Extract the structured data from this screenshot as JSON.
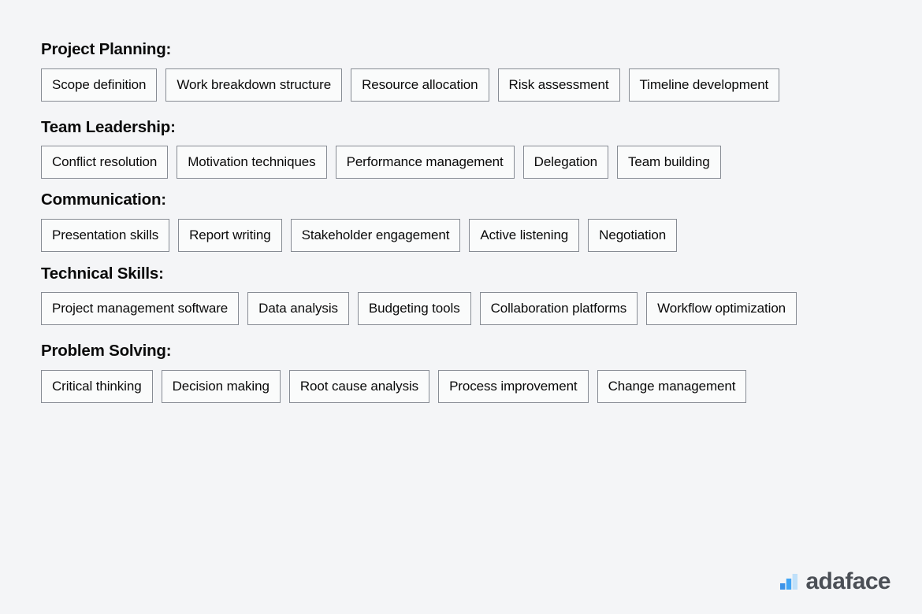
{
  "page": {
    "background_color": "#f4f5f7",
    "text_color": "#0a0a0a",
    "tag_border_color": "#878c94",
    "tag_fill_color": "#fafbfb"
  },
  "sections": [
    {
      "title": "Project Planning:",
      "tags": [
        "Scope definition",
        "Work breakdown structure",
        "Resource allocation",
        "Risk assessment",
        "Timeline development"
      ]
    },
    {
      "title": "Team Leadership:",
      "tags": [
        "Conflict resolution",
        "Motivation techniques",
        "Performance management",
        "Delegation",
        "Team building"
      ]
    },
    {
      "title": "Communication:",
      "tags": [
        "Presentation skills",
        "Report writing",
        "Stakeholder engagement",
        "Active listening",
        "Negotiation"
      ]
    },
    {
      "title": "Technical Skills:",
      "tags": [
        "Project management software",
        "Data analysis",
        "Budgeting tools",
        "Collaboration platforms",
        "Workflow optimization"
      ]
    },
    {
      "title": "Problem Solving:",
      "tags": [
        "Critical thinking",
        "Decision making",
        "Root cause analysis",
        "Process improvement",
        "Change management"
      ]
    }
  ],
  "brand": {
    "name": "adaface",
    "icon": "bar-chart-logo-icon",
    "name_color": "#4b4f56",
    "bar_colors": [
      "#3d93e8",
      "#41a5f5",
      "#bfe0fa"
    ]
  }
}
